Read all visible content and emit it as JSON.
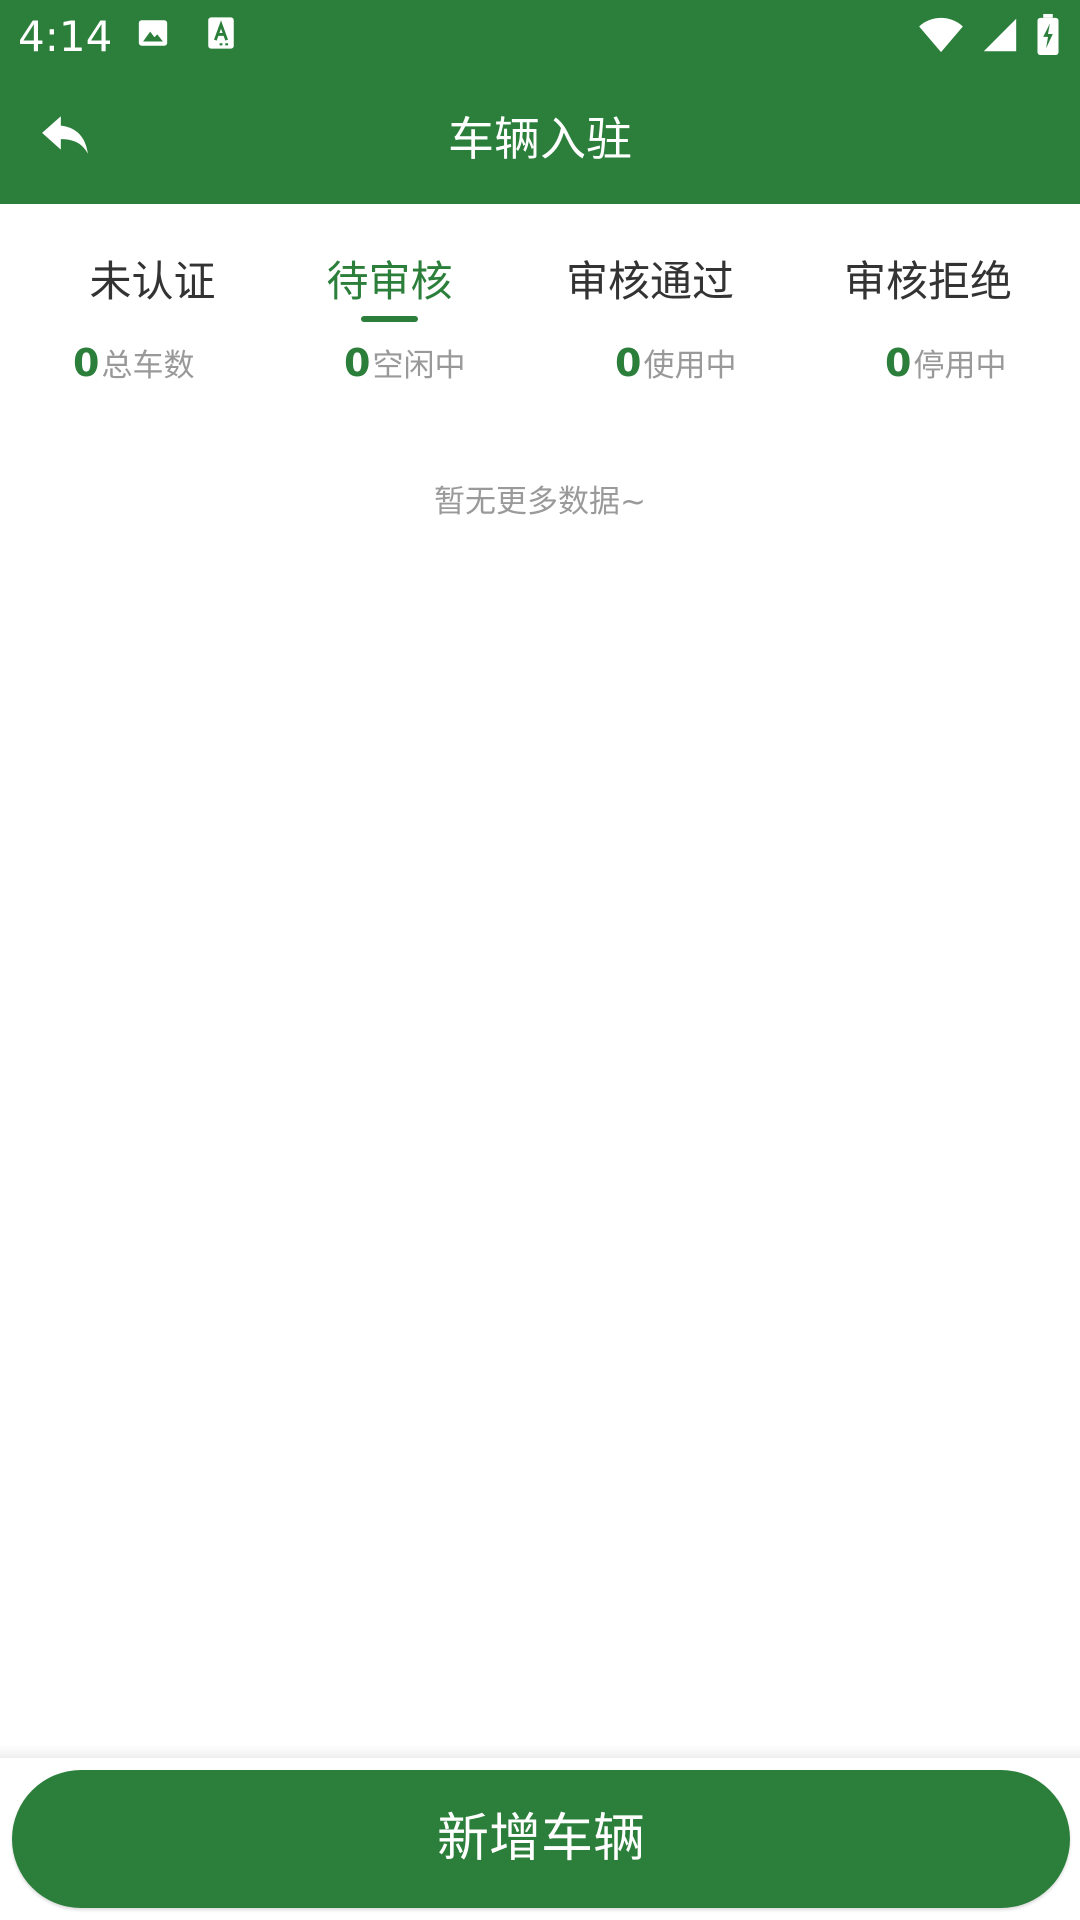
{
  "status_bar": {
    "time": "4:14",
    "icons": [
      "image-icon",
      "text-app-icon",
      "wifi-icon",
      "signal-icon",
      "battery-charging-icon"
    ]
  },
  "app_bar": {
    "title": "车辆入驻",
    "back_icon": "reply-back-icon"
  },
  "tabs": [
    {
      "label": "未认证",
      "active": false
    },
    {
      "label": "待审核",
      "active": true
    },
    {
      "label": "审核通过",
      "active": false
    },
    {
      "label": "审核拒绝",
      "active": false
    }
  ],
  "stats": [
    {
      "value": "0",
      "label": "总车数"
    },
    {
      "value": "0",
      "label": "空闲中"
    },
    {
      "value": "0",
      "label": "使用中"
    },
    {
      "value": "0",
      "label": "停用中"
    }
  ],
  "empty_state": {
    "text": "暂无更多数据~"
  },
  "bottom": {
    "add_button_label": "新增车辆"
  },
  "colors": {
    "primary": "#2b7f3b",
    "text_dark": "#333333",
    "text_muted": "#999999",
    "background": "#ffffff"
  }
}
